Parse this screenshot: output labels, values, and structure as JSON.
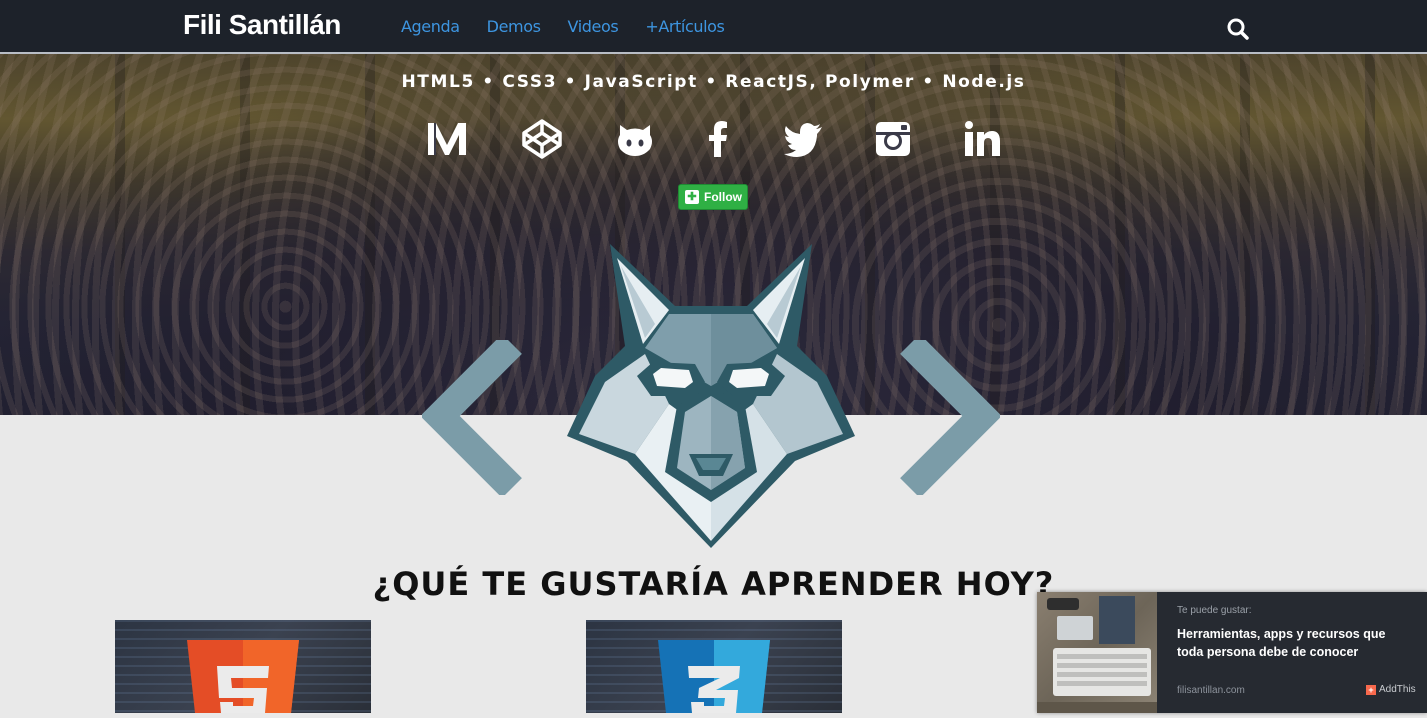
{
  "header": {
    "brand": "Fili Santillán",
    "nav": [
      "Agenda",
      "Demos",
      "Videos",
      "+Artículos"
    ],
    "search_icon": "search-icon"
  },
  "hero": {
    "tech_line": "HTML5 • CSS3 • JavaScript • ReactJS, Polymer • Node.js",
    "socials": [
      "medium-icon",
      "codepen-icon",
      "github-icon",
      "facebook-icon",
      "twitter-icon",
      "instagram-icon",
      "linkedin-icon"
    ],
    "follow_label": "Follow"
  },
  "main": {
    "headline": "¿QUÉ TE GUSTARÍA APRENDER HOY?",
    "cards": [
      {
        "badge": "5",
        "icon": "html5-icon",
        "color": "#e44d26"
      },
      {
        "badge": "3",
        "icon": "css3-icon",
        "color": "#1572b6"
      }
    ]
  },
  "recommendation": {
    "kicker": "Te puede gustar:",
    "title": "Herramientas, apps y recursos que toda persona debe de conocer",
    "site": "filisantillan.com",
    "brand": "AddThis"
  },
  "colors": {
    "nav_bg": "#1d222a",
    "nav_link": "#3d95e0",
    "page_bg": "#e9e9e9",
    "wolf_dark": "#2e5a66",
    "wolf_light": "#a9bfca",
    "follow_green": "#2fb044"
  }
}
